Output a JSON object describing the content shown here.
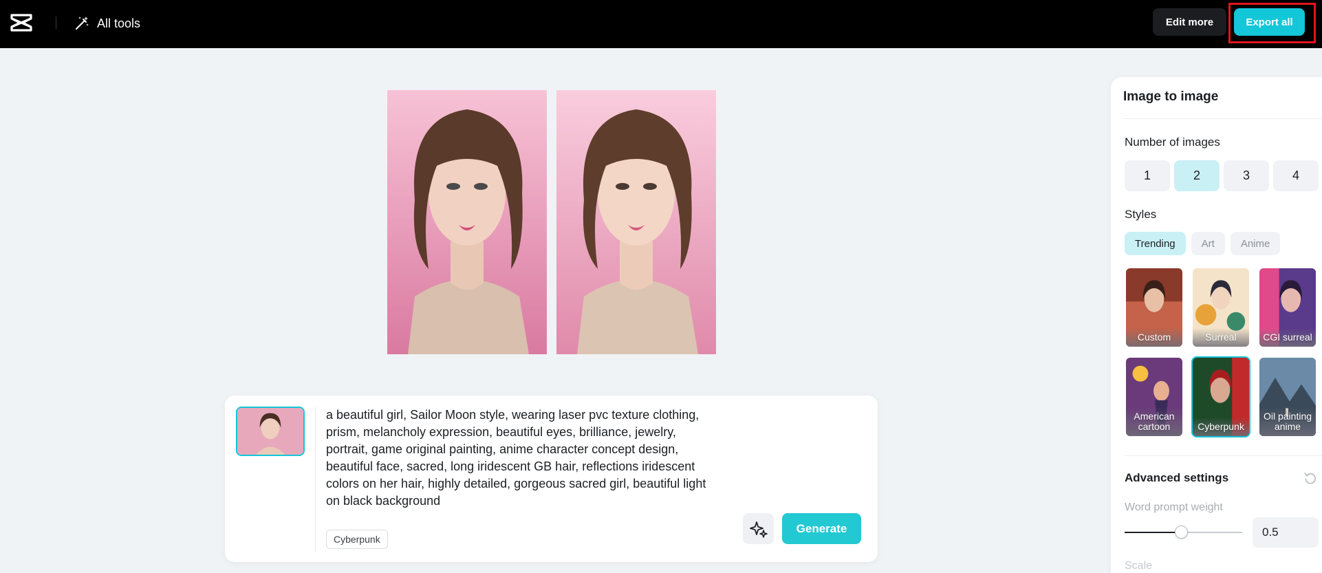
{
  "header": {
    "all_tools_label": "All tools",
    "edit_more_label": "Edit more",
    "export_all_label": "Export all"
  },
  "prompt": {
    "text": "a beautiful girl, Sailor Moon style, wearing laser pvc texture clothing, prism, melancholy expression, beautiful eyes, brilliance, jewelry, portrait, game original painting, anime character concept design, beautiful face, sacred, long iridescent GB hair, reflections iridescent colors on her hair, highly detailed, gorgeous sacred girl, beautiful light on black background",
    "style_chip": "Cyberpunk",
    "generate_label": "Generate"
  },
  "panel": {
    "title": "Image to image",
    "number_label": "Number of images",
    "numbers": [
      "1",
      "2",
      "3",
      "4"
    ],
    "selected_number": "2",
    "styles_label": "Styles",
    "tabs": [
      "Trending",
      "Art",
      "Anime"
    ],
    "active_tab": "Trending",
    "styles": [
      {
        "label": "Custom"
      },
      {
        "label": "Surreal"
      },
      {
        "label": "CGI surreal"
      },
      {
        "label": "American cartoon"
      },
      {
        "label": "Cyberpunk"
      },
      {
        "label": "Oil painting anime"
      }
    ],
    "selected_style": "Cyberpunk",
    "advanced_label": "Advanced settings",
    "word_weight_label": "Word prompt weight",
    "word_weight_value": "0.5",
    "word_weight_fraction": 0.48,
    "next_label": "Scale"
  },
  "colors": {
    "accent": "#13c6d8",
    "highlight": "#e0161b"
  }
}
